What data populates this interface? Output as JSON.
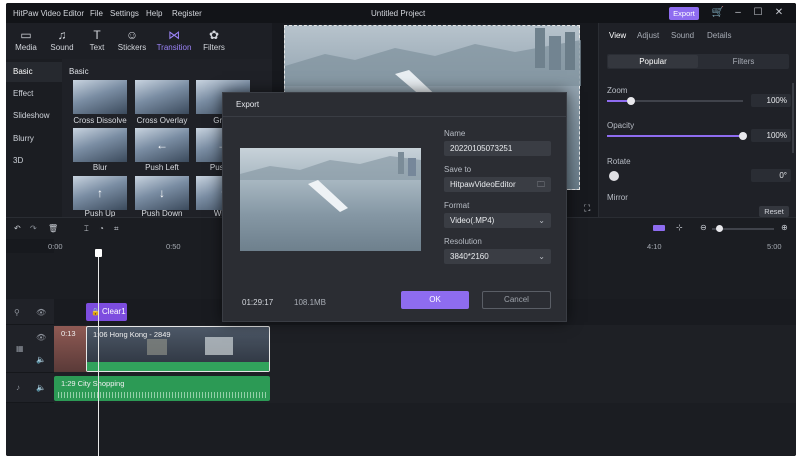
{
  "app": {
    "title": "HitPaw Video Editor",
    "menu": [
      "File",
      "Settings",
      "Help",
      "Register"
    ],
    "project_title": "Untitled Project",
    "export_label": "Export",
    "icons": {
      "cart": "cart-icon",
      "minimize": "minimize-icon",
      "maximize": "maximize-icon",
      "close": "close-icon"
    }
  },
  "toolbar": {
    "tools": [
      {
        "label": "Media",
        "icon": "media-icon",
        "glyph": "▭"
      },
      {
        "label": "Sound",
        "icon": "music-note-icon",
        "glyph": "♫"
      },
      {
        "label": "Text",
        "icon": "text-icon",
        "glyph": "T"
      },
      {
        "label": "Stickers",
        "icon": "smiley-icon",
        "glyph": "☺"
      },
      {
        "label": "Transition",
        "icon": "bowtie-icon",
        "glyph": "⋈"
      },
      {
        "label": "Filters",
        "icon": "filters-icon",
        "glyph": "✿"
      }
    ],
    "active": "Transition"
  },
  "categories": [
    "Basic",
    "Effect",
    "Slideshow",
    "Blurry",
    "3D"
  ],
  "selected_category": "Basic",
  "transitions": {
    "section": "Basic",
    "items": [
      {
        "label": "Cross Dissolve",
        "glyph": ""
      },
      {
        "label": "Cross Overlay",
        "glyph": ""
      },
      {
        "label": "Gradi",
        "glyph": ""
      },
      {
        "label": "Blur",
        "glyph": ""
      },
      {
        "label": "Push Left",
        "glyph": "←"
      },
      {
        "label": "Push R",
        "glyph": "→"
      },
      {
        "label": "Push Up",
        "glyph": "↑"
      },
      {
        "label": "Push Down",
        "glyph": "↓"
      },
      {
        "label": "Wipe",
        "glyph": "↑"
      }
    ]
  },
  "right_panel": {
    "tabs": [
      "View",
      "Adjust",
      "Sound",
      "Details"
    ],
    "selected_tab": "View",
    "segments": [
      "Popular",
      "Filters"
    ],
    "zoom": {
      "label": "Zoom",
      "value": "100%",
      "level": 0.18
    },
    "opacity": {
      "label": "Opacity",
      "value": "100%",
      "level": 1.0
    },
    "rotate": {
      "label": "Rotate",
      "value": "0°"
    },
    "mirror": {
      "label": "Mirror"
    },
    "reset_label": "Reset"
  },
  "timeline": {
    "ticks": [
      {
        "label": "0:00"
      },
      {
        "label": "0:50"
      },
      {
        "label": "4:10"
      },
      {
        "label": "5:00"
      }
    ],
    "chip": {
      "label": "Clear1"
    },
    "video_clips": [
      {
        "label": "0:13"
      },
      {
        "label": "1:06   Hong Kong - 2849"
      }
    ],
    "audio_clip": {
      "label": "1:29   City Shopping"
    }
  },
  "export_dialog": {
    "title": "Export",
    "name_label": "Name",
    "name_value": "20220105073251",
    "save_label": "Save to",
    "save_value": "HitpawVideoEditor",
    "format_label": "Format",
    "format_value": "Video(.MP4)",
    "resolution_label": "Resolution",
    "resolution_value": "3840*2160",
    "duration": "01:29:17",
    "size": "108.1MB",
    "ok_label": "OK",
    "cancel_label": "Cancel"
  },
  "colors": {
    "accent": "#8e6cf0",
    "background": "#17191e",
    "audio_track": "#2c9a55"
  }
}
